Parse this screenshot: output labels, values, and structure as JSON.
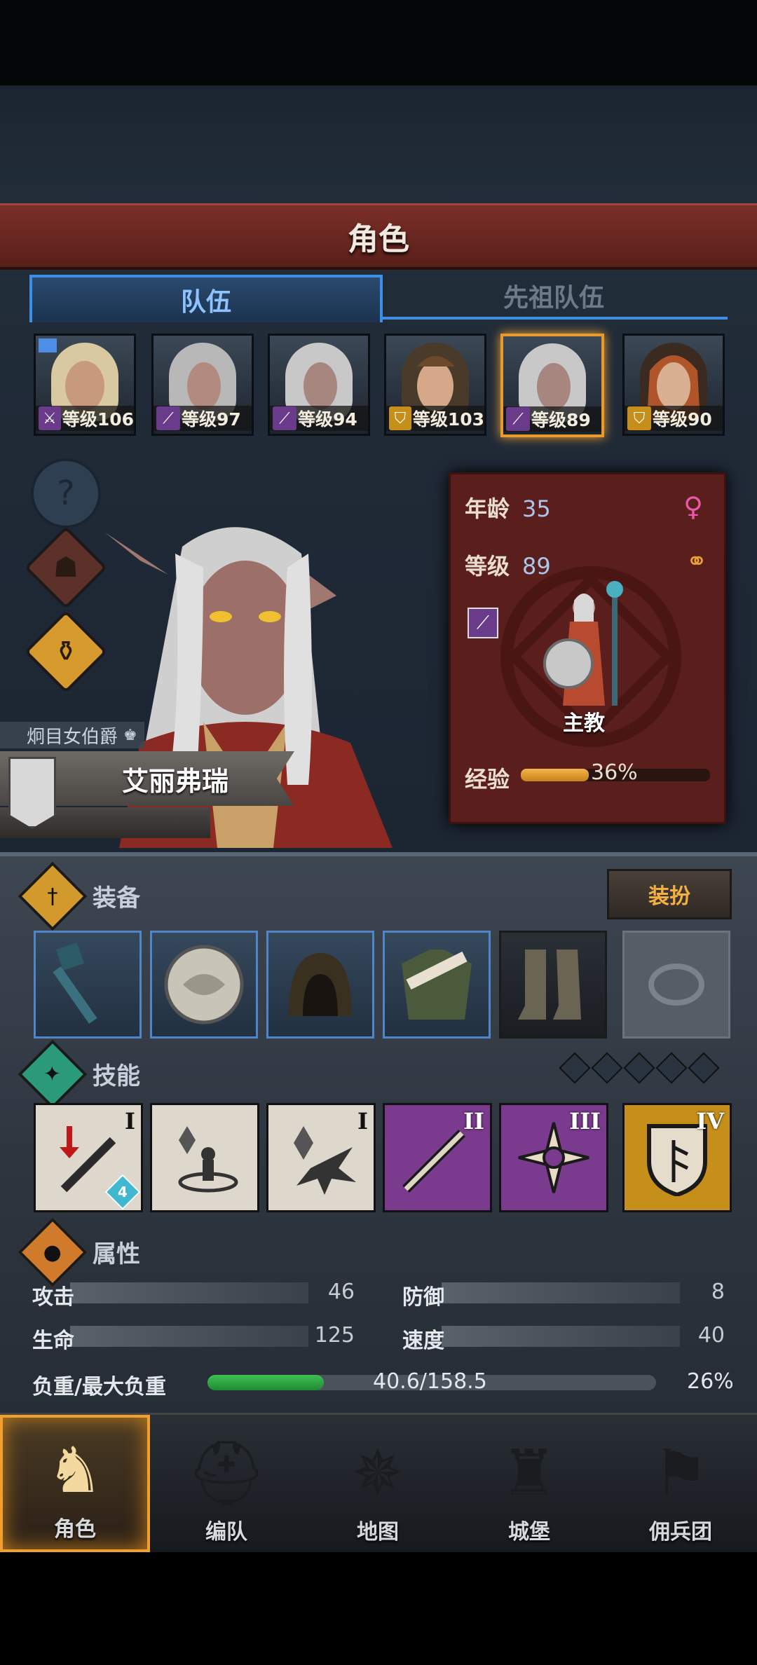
{
  "screen_title": "角色",
  "tabs": {
    "team": "队伍",
    "ancestor_team": "先祖队伍"
  },
  "roster": [
    {
      "level": "等级106",
      "class_icon": "sword-icon",
      "class_color": "#6a3b8a",
      "selected": false
    },
    {
      "level": "等级97",
      "class_icon": "staff-icon",
      "class_color": "#6a3b8a",
      "selected": false
    },
    {
      "level": "等级94",
      "class_icon": "staff-icon",
      "class_color": "#6a3b8a",
      "selected": false
    },
    {
      "level": "等级103",
      "class_icon": "shield-icon",
      "class_color": "#c68f1a",
      "selected": false
    },
    {
      "level": "等级89",
      "class_icon": "staff-icon",
      "class_color": "#6a3b8a",
      "selected": true
    },
    {
      "level": "等级90",
      "class_icon": "shield-icon",
      "class_color": "#c68f1a",
      "selected": false
    }
  ],
  "character": {
    "rank": "炯目女伯爵",
    "name": "艾丽弗瑞",
    "age_label": "年龄",
    "age": "35",
    "level_label": "等级",
    "level": "89",
    "class_name": "主教",
    "xp_label": "经验",
    "xp_percent": 36,
    "xp_text": "36%"
  },
  "sections": {
    "equipment": "装备",
    "dress_up": "装扮",
    "skills": "技能",
    "attributes": "属性"
  },
  "equipment": [
    "mace-icon",
    "round-shield-icon",
    "hood-icon",
    "fur-tunic-icon",
    "boots-icon",
    "ring-slot-icon"
  ],
  "skills": [
    {
      "icon": "sword-strike-icon",
      "tier": "I",
      "badge": "4",
      "style": "white"
    },
    {
      "icon": "crystal-heal-icon",
      "tier": "",
      "badge": "",
      "style": "white"
    },
    {
      "icon": "crystal-burst-icon",
      "tier": "I",
      "badge": "",
      "style": "white"
    },
    {
      "icon": "spear-thrust-icon",
      "tier": "II",
      "badge": "",
      "style": "purple"
    },
    {
      "icon": "holy-cross-icon",
      "tier": "III",
      "badge": "",
      "style": "purple"
    },
    {
      "icon": "rune-shield-icon",
      "tier": "IV",
      "badge": "",
      "style": "gold"
    }
  ],
  "stats": {
    "attack_label": "攻击",
    "attack": "46",
    "defense_label": "防御",
    "defense": "8",
    "health_label": "生命",
    "health": "125",
    "speed_label": "速度",
    "speed": "40",
    "load_label": "负重/最大负重",
    "load": "40.6/158.5",
    "load_percent": "26%",
    "load_fraction": 0.26
  },
  "nav": [
    {
      "label": "角色",
      "icon": "knight-icon",
      "active": true
    },
    {
      "label": "编队",
      "icon": "helmet-icon",
      "active": false
    },
    {
      "label": "地图",
      "icon": "compass-map-icon",
      "active": false
    },
    {
      "label": "城堡",
      "icon": "castle-icon",
      "active": false
    },
    {
      "label": "佣兵团",
      "icon": "mercenary-icon",
      "active": false
    }
  ]
}
